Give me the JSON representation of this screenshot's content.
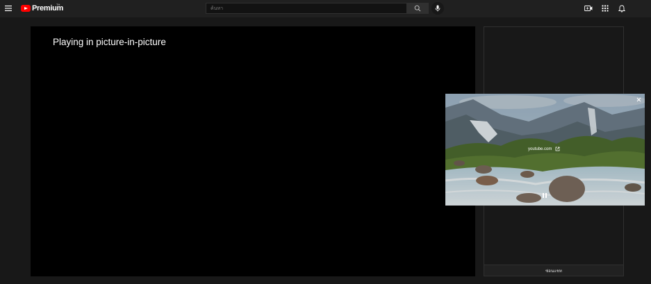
{
  "header": {
    "logo_text": "Premium",
    "logo_region": "TH",
    "search": {
      "placeholder": "ค้นหา",
      "value": ""
    }
  },
  "icons": {
    "menu": "menu-icon",
    "search": "search-icon",
    "mic": "microphone-icon",
    "create": "create-video-icon",
    "apps": "apps-grid-icon",
    "notifications": "bell-icon"
  },
  "player": {
    "message": "Playing in picture-in-picture"
  },
  "chat": {
    "footer_label": "ซ่อนแชท"
  },
  "pip": {
    "source_label": "youtube.com",
    "state": "playing"
  },
  "colors": {
    "brand": "#ff0000",
    "topbar": "#202020",
    "background": "#181818"
  }
}
